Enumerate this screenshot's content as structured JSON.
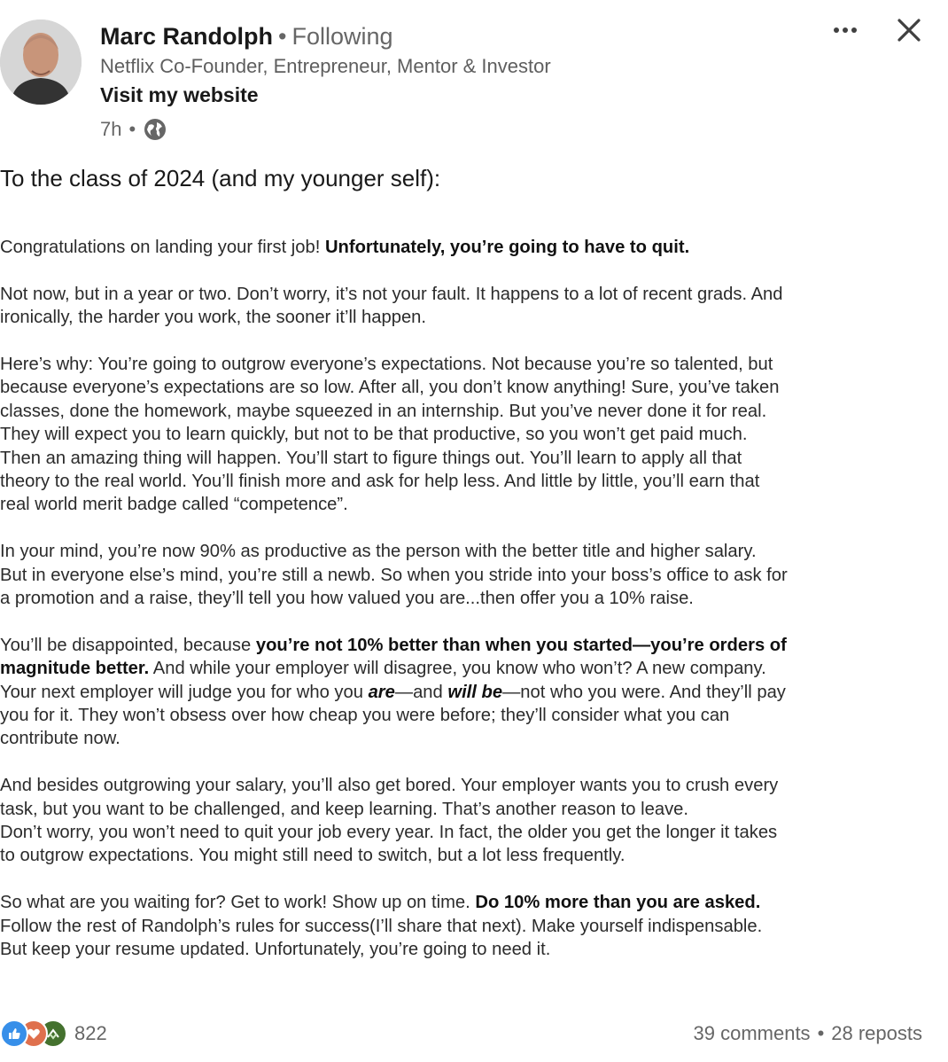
{
  "author": {
    "name": "Marc Randolph",
    "follow_status": "Following",
    "headline": "Netflix Co-Founder, Entrepreneur, Mentor & Investor",
    "website_link": "Visit my website",
    "time_ago": "7h",
    "separator": "•"
  },
  "post": {
    "intro": "To the class of 2024 (and my younger self):",
    "p1": {
      "a": "Congratulations on landing your first job! ",
      "b": "Unfortunately, you’re going to have to quit."
    },
    "p2": [
      "Not now, but in a year or two. Don’t worry, it’s not your fault. It happens to a lot of recent grads. And",
      "ironically, the harder you work, the sooner it’ll happen."
    ],
    "p3": [
      "Here’s why: You’re going to outgrow everyone’s expectations. Not because you’re so talented, but",
      "because everyone’s expectations are so low. After all, you don’t know anything! Sure, you’ve taken",
      "classes, done the homework, maybe squeezed in an internship. But you’ve never done it for real.",
      "They will expect you to learn quickly, but not to be that productive, so you won’t get paid much.",
      "Then an amazing thing will happen. You’ll start to figure things out. You’ll learn to apply all that",
      "theory to the real world. You’ll finish more and ask for help less. And little by little, you’ll earn that",
      "real world merit badge called “competence”."
    ],
    "p4": [
      "In your mind, you’re now 90% as productive as the person with the better title and higher salary.",
      "But in everyone else’s mind, you’re still a newb. So when you stride into your boss’s office to ask for",
      "a promotion and a raise, they’ll tell you how valued you are...then offer you a 10% raise."
    ],
    "p5": {
      "l1a": "You’ll be disappointed, because ",
      "l1b": "you’re not 10% better than when you started—you’re orders of",
      "l2a": "magnitude better.",
      "l2b": " And while your employer will disagree, you know who won’t? A new company.",
      "l3a": "Your next employer will judge you for who you ",
      "l3b": "are",
      "l3c": "—and ",
      "l3d": "will be",
      "l3e": "—not who you were. And they’ll pay",
      "l4": "you for it. They won’t obsess over how cheap you were before; they’ll consider what you can",
      "l5": "contribute now."
    },
    "p6": [
      "And besides outgrowing your salary, you’ll also get bored. Your employer wants you to crush every",
      "task, but you want to be challenged, and keep learning. That’s another reason to leave.",
      "Don’t worry, you won’t need to quit your job every year. In fact, the older you get the longer it takes",
      "to outgrow expectations. You might still need to switch, but a lot less frequently."
    ],
    "p7": {
      "l1a": "So what are you waiting for? Get to work! Show up on time. ",
      "l1b": "Do 10% more than you are asked.",
      "l2": "Follow the rest of Randolph’s rules for success(I’ll share that next). Make yourself indispensable.",
      "l3": "But keep your resume updated. Unfortunately, you’re going to need it."
    }
  },
  "social": {
    "reaction_count": "822",
    "comments": "39 comments",
    "reposts": "28 reposts",
    "reaction_icons": [
      "like-icon",
      "love-icon",
      "support-icon"
    ]
  },
  "colors": {
    "like": "#378fe9",
    "love": "#df704d",
    "support": "#44712e",
    "secondary_text": "#666666"
  }
}
